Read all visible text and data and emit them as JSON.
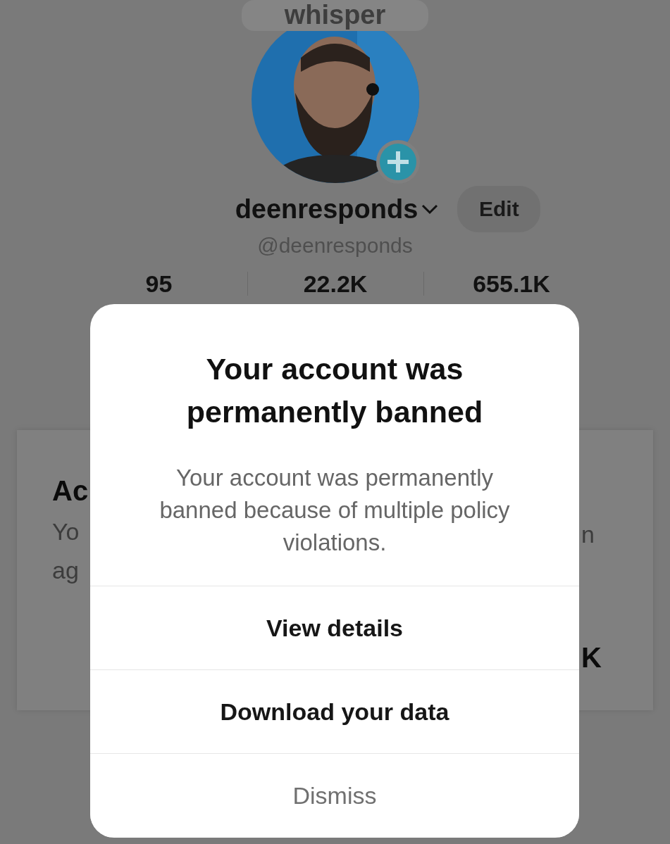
{
  "profile": {
    "bubble_text": "whisper",
    "display_name": "deenresponds",
    "edit_button": "Edit",
    "handle": "@deenresponds",
    "stats": [
      "95",
      "22.2K",
      "655.1K"
    ]
  },
  "background_sheet": {
    "left_fragments": [
      {
        "text": "Ac",
        "kind": "title"
      },
      {
        "text": "Yo",
        "kind": "body"
      },
      {
        "text": "ag",
        "kind": "body"
      }
    ],
    "right_fragments": [
      {
        "text": "n",
        "kind": "body"
      },
      {
        "text": "K",
        "kind": "title"
      }
    ]
  },
  "dialog": {
    "title": "Your account was permanently banned",
    "message": "Your account was permanently banned because of multiple policy violations.",
    "actions": [
      {
        "label": "View details",
        "kind": "primary"
      },
      {
        "label": "Download your data",
        "kind": "primary"
      },
      {
        "label": "Dismiss",
        "kind": "secondary"
      }
    ]
  }
}
